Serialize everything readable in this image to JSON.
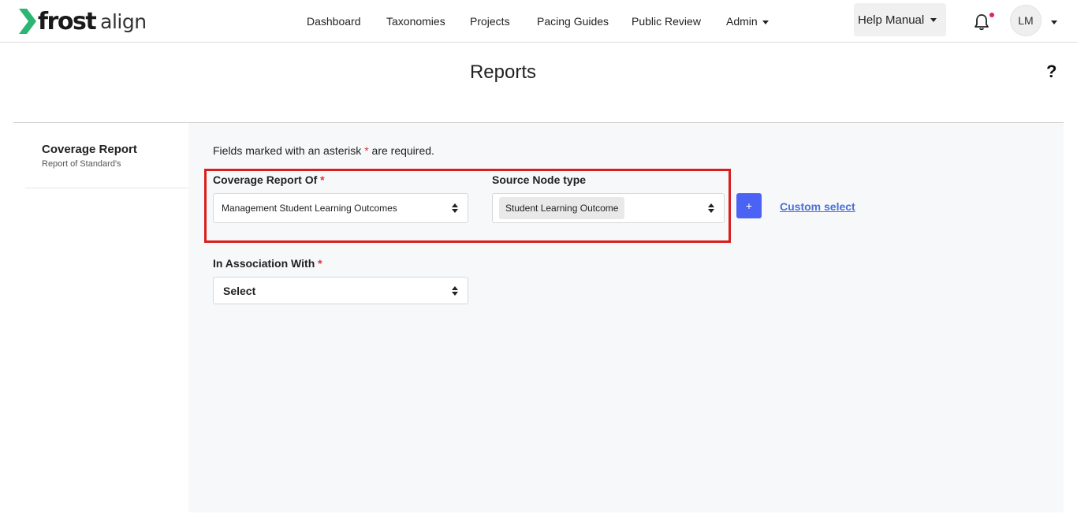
{
  "brand": {
    "name_bold": "frost",
    "name_light": "align",
    "accent_color": "#2bb673"
  },
  "nav": {
    "items": [
      {
        "label": "Dashboard"
      },
      {
        "label": "Taxonomies"
      },
      {
        "label": "Projects"
      },
      {
        "label": "Pacing Guides"
      },
      {
        "label": "Public Review"
      },
      {
        "label": "Admin"
      }
    ],
    "help_label": "Help Manual",
    "notification_icon": "bell-icon",
    "avatar_initials": "LM"
  },
  "page": {
    "title": "Reports",
    "help_icon": "?"
  },
  "sidebar": {
    "card_title": "Coverage Report",
    "card_subtitle": "Report of Standard's"
  },
  "form": {
    "required_note_pre": "Fields marked with an asterisk ",
    "required_note_star": "*",
    "required_note_post": " are required.",
    "coverage_label": "Coverage Report Of",
    "coverage_value": "Management Student Learning Outcomes",
    "source_label": "Source Node type",
    "source_value": "Student Learning Outcome",
    "add_label": "+",
    "custom_select_label": "Custom select",
    "association_label": "In Association With",
    "association_value": "Select",
    "required_mark": "*",
    "highlight_color": "#d81e1e",
    "button_color": "#4a63f4"
  }
}
